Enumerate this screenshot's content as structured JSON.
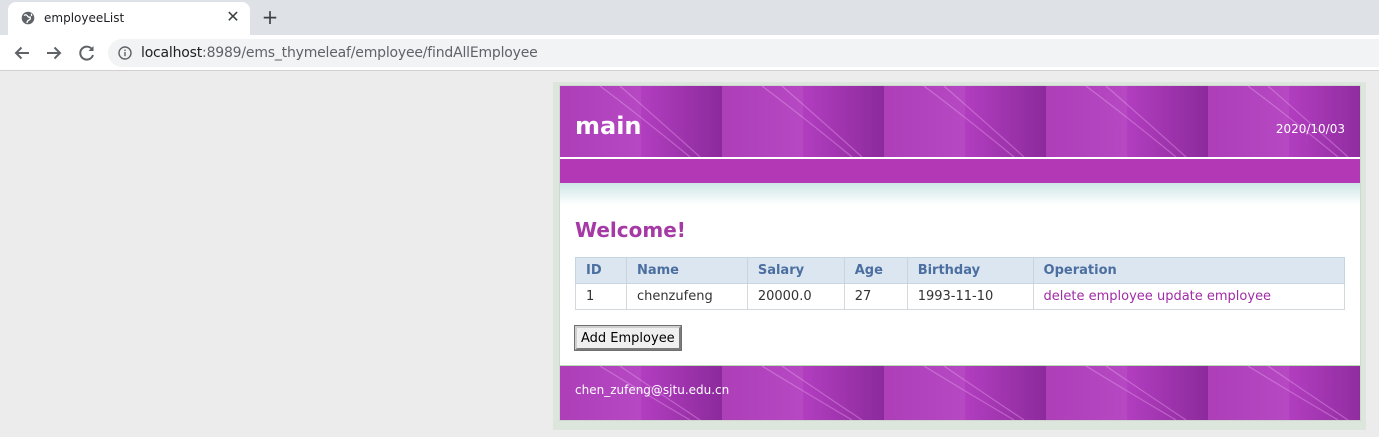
{
  "browser": {
    "tab_title": "employeeList",
    "url_host": "localhost",
    "url_rest": ":8989/ems_thymeleaf/employee/findAllEmployee"
  },
  "header": {
    "title": "main",
    "date": "2020/10/03"
  },
  "content": {
    "welcome": "Welcome!",
    "columns": [
      "ID",
      "Name",
      "Salary",
      "Age",
      "Birthday",
      "Operation"
    ],
    "rows": [
      {
        "id": "1",
        "name": "chenzufeng",
        "salary": "20000.0",
        "age": "27",
        "birthday": "1993-11-10",
        "delete_label": "delete employee",
        "update_label": "update employee"
      }
    ],
    "add_button": "Add Employee"
  },
  "footer": {
    "email": "chen_zufeng@sjtu.edu.cn"
  },
  "colors": {
    "banner": "#a833b4",
    "accent": "#a53aa6",
    "table_header": "#dce6f0",
    "link": "#a02ca6"
  }
}
